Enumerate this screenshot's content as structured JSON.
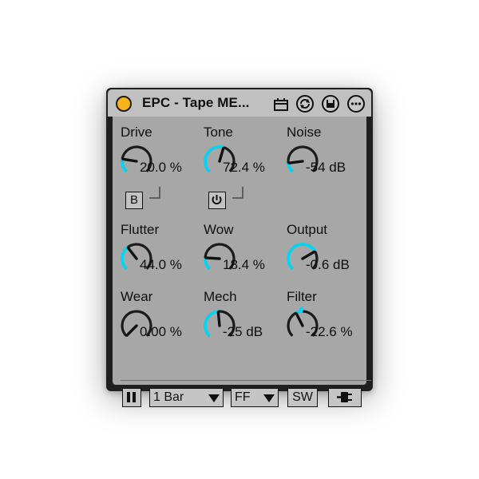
{
  "device": {
    "title": "EPC - Tape ME...",
    "colors": {
      "accent": "#00d6f5",
      "power": "#f9b31b",
      "panel": "#a7a7a7",
      "title_bar": "#c0c0c0"
    }
  },
  "knobs": [
    {
      "id": "drive",
      "label": "Drive",
      "value": "20.0 %",
      "level": 0.2
    },
    {
      "id": "tone",
      "label": "Tone",
      "value": "72.4 %",
      "level": 0.56
    },
    {
      "id": "noise",
      "label": "Noise",
      "value": "-54 dB",
      "level": 0.14
    },
    {
      "id": "flutter",
      "label": "Flutter",
      "value": "44.0 %",
      "level": 0.36
    },
    {
      "id": "wow",
      "label": "Wow",
      "value": "18.4 %",
      "level": 0.18
    },
    {
      "id": "output",
      "label": "Output",
      "value": "-0.6 dB",
      "level": 0.72
    },
    {
      "id": "wear",
      "label": "Wear",
      "value": "0.00 %",
      "level": 0.0
    },
    {
      "id": "mech",
      "label": "Mech",
      "value": "-25 dB",
      "level": 0.48
    },
    {
      "id": "filter",
      "label": "Filter",
      "value": "-22.6 %",
      "level": -0.2,
      "bipolar": true
    }
  ],
  "buttons": {
    "drive_b": "B"
  },
  "bottom_bar": {
    "bar_select": "1 Bar",
    "mode_select": "FF",
    "sw_button": "SW"
  },
  "icons": [
    "power-dot-icon",
    "clip-icon",
    "hot-swap-icon",
    "save-preset-icon",
    "more-icon",
    "pause-icon",
    "power-toggle-icon",
    "plug-icon"
  ]
}
